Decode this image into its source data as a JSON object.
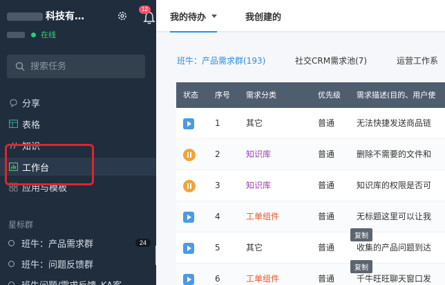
{
  "org": {
    "name_visible": "科技有…",
    "notification_count": "12",
    "status": "在线"
  },
  "search": {
    "placeholder": "搜索任务"
  },
  "nav": [
    {
      "label": "分享",
      "icon": "share-icon"
    },
    {
      "label": "表格",
      "icon": "table-icon"
    },
    {
      "label": "知识",
      "icon": "knowledge-icon"
    },
    {
      "label": "工作台",
      "icon": "dashboard-icon"
    },
    {
      "label": "应用与模板",
      "icon": "apps-icon"
    }
  ],
  "starred": {
    "label": "星标群",
    "items": [
      {
        "label": "班牛：产品需求群",
        "count": "24"
      },
      {
        "label": "班牛：问题反馈群",
        "count": ""
      },
      {
        "label": "班牛问题/需求反馈_KA客",
        "count": ""
      }
    ]
  },
  "tabs": [
    {
      "label": "我的待办"
    },
    {
      "label": "我创建的"
    }
  ],
  "pools": [
    {
      "label": "班牛：产品需求群(193)"
    },
    {
      "label": "社交CRM需求池(7)"
    },
    {
      "label": "运营工作系"
    }
  ],
  "table": {
    "columns": [
      "状态",
      "序号",
      "需求分类",
      "优先级",
      "需求描述(目的、用户使"
    ],
    "rows": [
      {
        "status": "play",
        "no": "1",
        "category": "其它",
        "category_color": "#333333",
        "priority": "普通",
        "desc": "无法快捷发送商品链"
      },
      {
        "status": "pause",
        "no": "2",
        "category": "知识库",
        "category_color": "#9b3fb5",
        "priority": "普通",
        "desc": "删除不需要的文件和"
      },
      {
        "status": "pause",
        "no": "3",
        "category": "知识库",
        "category_color": "#9b3fb5",
        "priority": "普通",
        "desc": "知识库的权限是否可"
      },
      {
        "status": "play",
        "no": "4",
        "category": "工单组件",
        "category_color": "#e8562a",
        "priority": "普通",
        "desc": "无标题这里可以让我"
      },
      {
        "status": "play",
        "no": "5",
        "category": "其它",
        "category_color": "#333333",
        "priority": "普通",
        "desc": "收集的产品问题到达"
      },
      {
        "status": "play",
        "no": "6",
        "category": "工单组件",
        "category_color": "#e8562a",
        "priority": "普通",
        "desc": "千牛旺旺聊天窗口发"
      }
    ],
    "copy_label": "复制"
  },
  "colors": {
    "sidebar_bg": "#1f2d3d",
    "accent": "#2a8ee0",
    "highlight": "#e0242f",
    "online": "#2ecc71"
  }
}
